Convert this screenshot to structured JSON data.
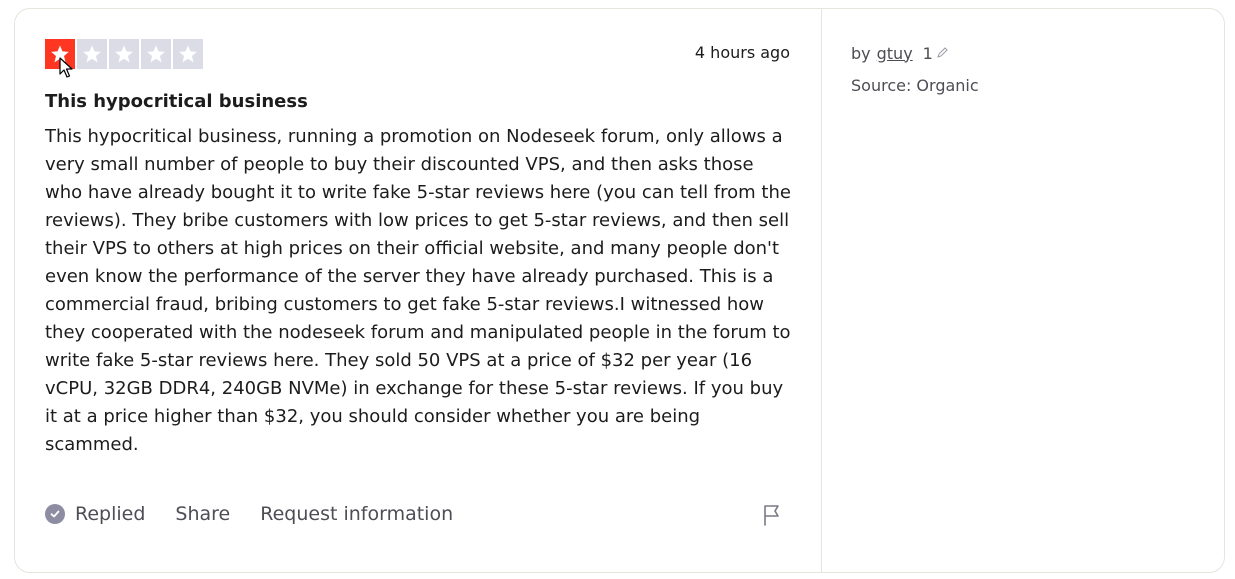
{
  "review": {
    "rating": 1,
    "max_rating": 5,
    "date": "4 hours ago",
    "title": "This hypocritical business",
    "body": "This hypocritical business, running a promotion on Nodeseek forum, only allows a very small number of people to buy their discounted VPS, and then asks those who have already bought it to write fake 5-star reviews here (you can tell from the reviews). They bribe customers with low prices to get 5-star reviews, and then sell their VPS to others at high prices on their official website, and many people don't even know the performance of the server they have already purchased. This is a commercial fraud, bribing customers to get fake 5-star reviews.I witnessed how they cooperated with the nodeseek forum and manipulated people in the forum to write fake 5-star reviews here. They sold 50 VPS at a price of $32 per year (16 vCPU, 32GB DDR4, 240GB NVMe) in exchange for these 5-star reviews. If you buy it at a price higher than $32, you should consider whether you are being scammed."
  },
  "actions": {
    "replied_label": "Replied",
    "share_label": "Share",
    "request_info_label": "Request information"
  },
  "sidebar": {
    "by_prefix": "by",
    "author": "gtuy",
    "review_count": "1",
    "source": "Source: Organic"
  },
  "colors": {
    "star_filled": "#ff3722",
    "star_empty": "#dcdce6",
    "replied_badge": "#8c8ca3"
  },
  "icons": {
    "star": "star-icon",
    "replied": "check-circle-icon",
    "flag": "flag-icon",
    "edit": "pencil-icon",
    "cursor": "mouse-cursor-icon"
  }
}
